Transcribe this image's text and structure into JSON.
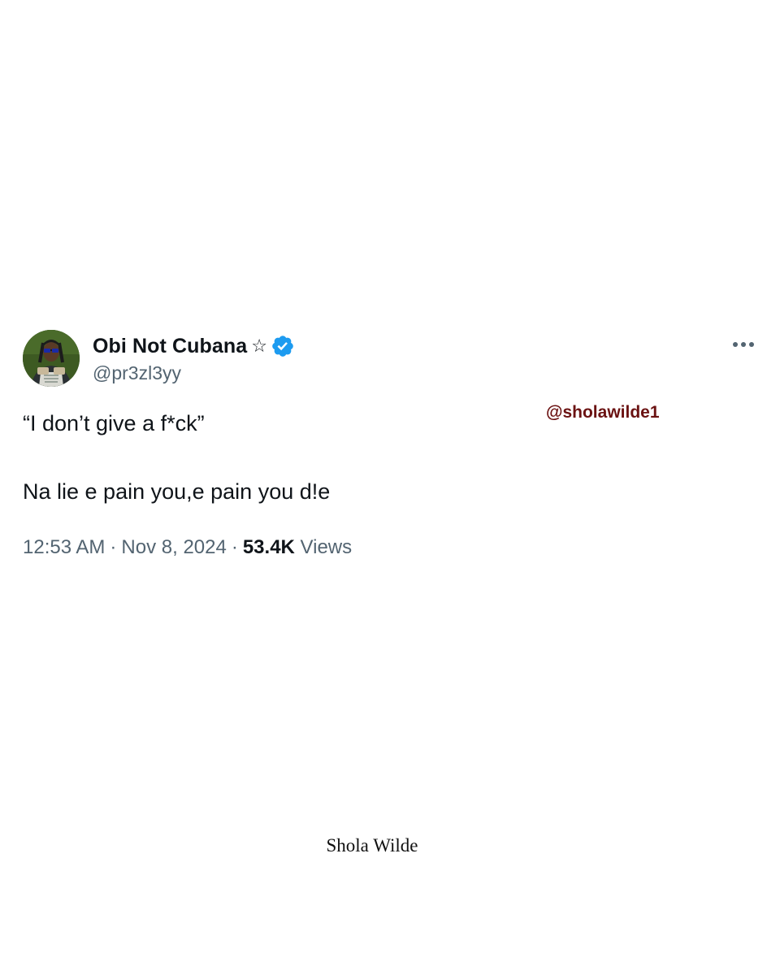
{
  "author": {
    "display_name": "Obi Not Cubana",
    "star_glyph": "☆",
    "handle": "@pr3zl3yy",
    "verified": true,
    "verified_color": "#1d9bf0"
  },
  "tweet": {
    "line1": "“I don’t give a f*ck”",
    "line2": "Na lie e pain you,e pain you d!e"
  },
  "meta": {
    "time": "12:53 AM",
    "separator": "·",
    "date": "Nov 8, 2024",
    "views_count": "53.4K",
    "views_label": "Views"
  },
  "overlay": {
    "watermark_handle": "@sholawilde1",
    "watermark_color": "#6b1212",
    "signature": "Shola Wilde"
  },
  "icons": {
    "more": "more-horizontal-icon",
    "verified": "verified-badge-icon",
    "avatar": "avatar-image"
  }
}
